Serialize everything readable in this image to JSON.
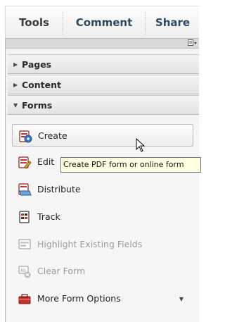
{
  "tabs": {
    "tools": "Tools",
    "comment": "Comment",
    "share": "Share"
  },
  "sections": {
    "pages": "Pages",
    "content": "Content",
    "forms": "Forms"
  },
  "forms_items": {
    "create": "Create",
    "edit": "Edit",
    "distribute": "Distribute",
    "track": "Track",
    "highlight": "Highlight Existing Fields",
    "clear": "Clear Form",
    "more": "More Form Options"
  },
  "tooltip": "Create PDF form or online form",
  "colors": {
    "tab_text": "#2f4a63",
    "panel_bg": "#f3f3f3",
    "tooltip_bg": "#ffffe1",
    "disabled_text": "#9b9b9b",
    "icon_red": "#c8332b"
  }
}
